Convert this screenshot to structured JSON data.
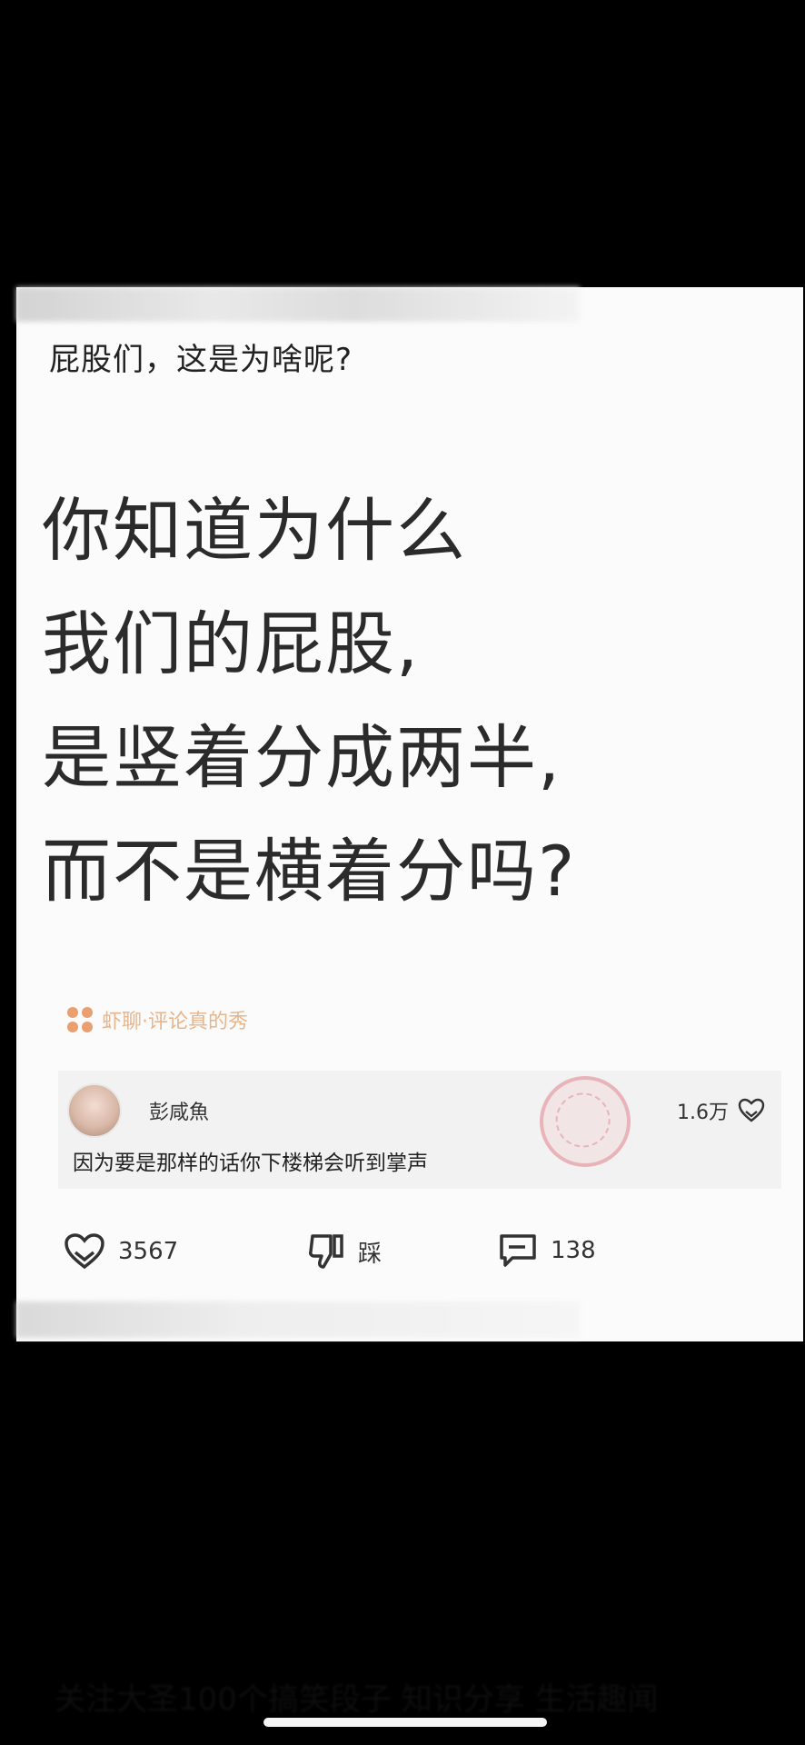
{
  "post": {
    "question_title": "屁股们，这是为啥呢?",
    "big_text_lines": [
      "你知道为什么",
      "我们的屁股,",
      "是竖着分成两半,",
      "而不是横着分吗?"
    ],
    "source_tag": "虾聊·评论真的秀"
  },
  "comment": {
    "author": "彭咸魚",
    "text": "因为要是那样的话你下楼梯会听到掌声",
    "likes": "1.6万"
  },
  "actions": {
    "likes_count": "3567",
    "dislike_label": "踩",
    "comments_count": "138"
  },
  "bottom_caption": "关注大圣100个搞笑段子 知识分享 生活趣闻",
  "colors": {
    "background": "#000000",
    "card": "#fbfbfb",
    "source_tag": "#e6b58c",
    "text_dark": "#2b2b2b"
  }
}
